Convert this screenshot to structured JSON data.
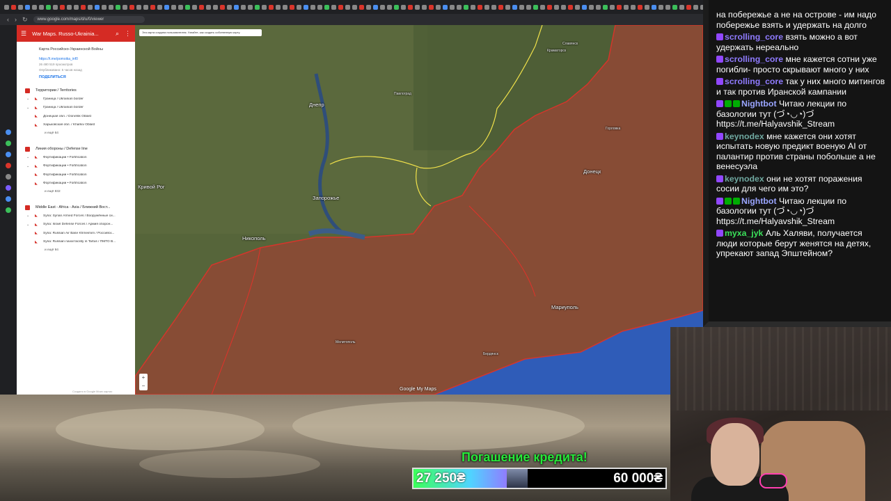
{
  "browser": {
    "url": "www.google.com/maps/d/u/0/viewer"
  },
  "panel": {
    "header_title": "War Maps. Russo-Ukrainia...",
    "map_title": "Карта Российско-Украинской Войны",
    "link": "https://t.me/pomoika_inf0",
    "views": "26 480 519 просмотров",
    "published": "Опубликовано: 5 часов назад",
    "share_label": "ПОДЕЛИТЬСЯ",
    "footer": "Создано в Google Моих картах",
    "layers": [
      {
        "title": "Территории / Territories",
        "items": [
          "Граница / Ukrainian border",
          "Граница / Ukrainian border",
          "Донецкая обл. / Donetsk Oblast",
          "Харьковская обл. / Kharkiv Oblast"
        ],
        "more": "и ещё 64"
      },
      {
        "title": "Линия обороны / Defense line",
        "items": [
          "Фортификации • Fortification",
          "Фортификации • Fortification",
          "Фортификации • Fortification",
          "Фортификации • Fortification"
        ],
        "more": "и ещё 832"
      },
      {
        "title": "Middle East - Africa - Asia / Ближний Вост...",
        "items": [
          "Syria: Syrian Armed Forces / Вооружённые си...",
          "Syria: Israel Defense Forces / Армия оборон...",
          "Syria: Russian Air Base Khmeimim / Российск...",
          "Syria: Russian naval facility in Tartus / ПМТО В..."
        ],
        "more": "и ещё 94"
      }
    ]
  },
  "map": {
    "notice": "Эта карта создана пользователем. Узнайте, как создать собственную карту.",
    "logo": "Google My Maps",
    "zoom_in": "+",
    "zoom_out": "−",
    "cities": [
      {
        "name": "Днепр",
        "size": "big"
      },
      {
        "name": "Запорожье",
        "size": "big"
      },
      {
        "name": "Кривой Рог",
        "size": "big"
      },
      {
        "name": "Никополь",
        "size": "big"
      },
      {
        "name": "Мариуполь",
        "size": "big"
      },
      {
        "name": "Донецк",
        "size": "big"
      },
      {
        "name": "Павлоград",
        "size": "small"
      },
      {
        "name": "Краматорск",
        "size": "small"
      },
      {
        "name": "Мелитополь",
        "size": "small"
      },
      {
        "name": "Бердянск",
        "size": "small"
      },
      {
        "name": "Горловка",
        "size": "small"
      },
      {
        "name": "Славянск",
        "size": "small"
      }
    ]
  },
  "chat": {
    "messages": [
      {
        "user": "",
        "color": "#ffffff",
        "badges": [],
        "text": "на побережье а не на острове - им надо побережье взять и удержать на долго"
      },
      {
        "user": "scrolling_core",
        "color": "#8f7bff",
        "badges": [
          "twitch"
        ],
        "text": "взять можно а вот удержать нереально"
      },
      {
        "user": "scrolling_core",
        "color": "#8f7bff",
        "badges": [
          "twitch"
        ],
        "text": "мне кажется сотни уже погибли- просто скрывают много у них"
      },
      {
        "user": "scrolling_core",
        "color": "#8f7bff",
        "badges": [
          "twitch"
        ],
        "text": "так у них много митингов и так против Иранской кампании"
      },
      {
        "user": "Nightbot",
        "color": "#9aa5ff",
        "badges": [
          "twitch",
          "mod",
          "mod"
        ],
        "text": "Читаю лекции по базологии тут (づ◔◡◔)づ https://t.me/Halyavshik_Stream"
      },
      {
        "user": "keynodex",
        "color": "#6fa8a0",
        "badges": [
          "twitch"
        ],
        "text": "мне кажется они хотят испытать новую предикт военую AI от палантир против страны побольше а не венесуэла"
      },
      {
        "user": "keynodex",
        "color": "#6fa8a0",
        "badges": [
          "twitch"
        ],
        "text": "они не хотят поражения сосии для чего им это?"
      },
      {
        "user": "Nightbot",
        "color": "#9aa5ff",
        "badges": [
          "twitch",
          "mod",
          "mod"
        ],
        "text": "Читаю лекции по базологии тут (づ◔◡◔)づ https://t.me/Halyavshik_Stream"
      },
      {
        "user": "myxa_jyk",
        "color": "#3be05a",
        "badges": [
          "twitch"
        ],
        "text": "Аль Халяви, получается люди которые берут женятся на детях, упрекают запад Эпштейном?"
      }
    ]
  },
  "goal": {
    "title": "Погашение кредита!",
    "current": "27 250₴",
    "target": "60 000₴",
    "progress": 0.45
  },
  "colors": {
    "occupied": "#8c4a35",
    "frontline": "#e0322a",
    "oblast_border": "#f0e14a",
    "sea": "#2f5cb8",
    "panel_accent": "#d52b24"
  }
}
